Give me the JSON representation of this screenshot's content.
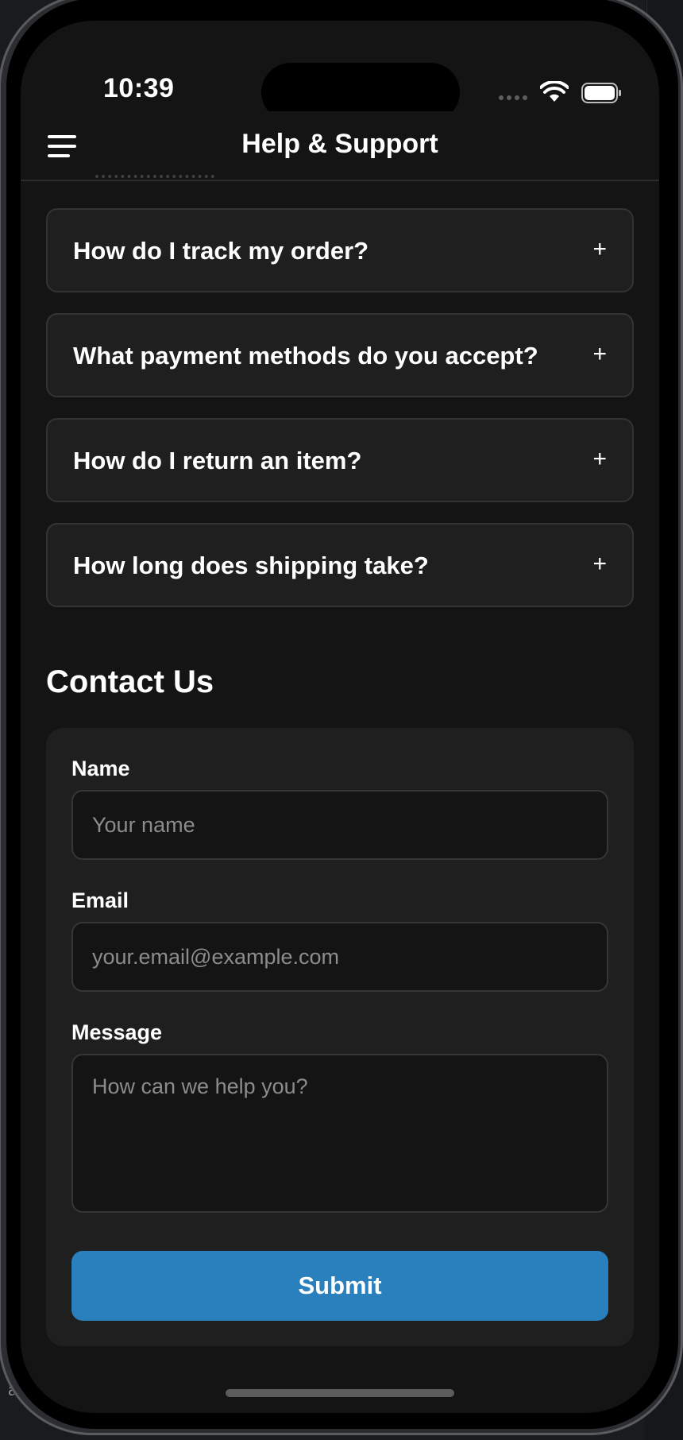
{
  "status_bar": {
    "time": "10:39"
  },
  "header": {
    "title": "Help & Support"
  },
  "faq": {
    "items": [
      {
        "question": "How do I track my order?",
        "toggle": "+"
      },
      {
        "question": "What payment methods do you accept?",
        "toggle": "+"
      },
      {
        "question": "How do I return an item?",
        "toggle": "+"
      },
      {
        "question": "How long does shipping take?",
        "toggle": "+"
      }
    ]
  },
  "contact": {
    "title": "Contact Us",
    "name_label": "Name",
    "name_placeholder": "Your name",
    "email_label": "Email",
    "email_placeholder": "your.email@example.com",
    "message_label": "Message",
    "message_placeholder": "How can we help you?",
    "submit_label": "Submit"
  },
  "colors": {
    "accent": "#2a7fbd",
    "background": "#141414",
    "card": "#1f1f1f"
  },
  "icons": [
    "menu-icon",
    "wifi-icon",
    "battery-icon",
    "plus-icon"
  ]
}
